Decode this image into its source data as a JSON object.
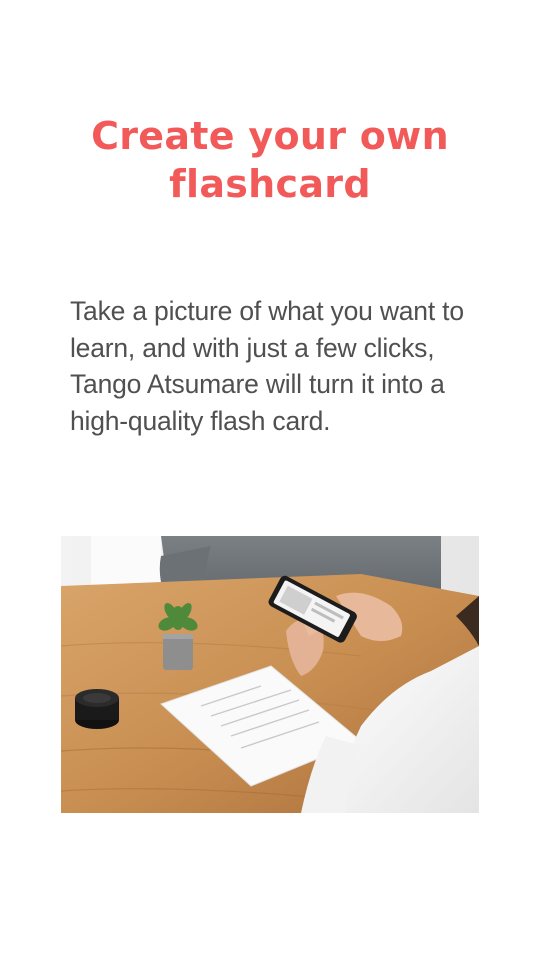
{
  "header": {
    "title": "Create your own flashcard"
  },
  "body": {
    "description": "Take a picture of what you want to learn, and with just a few clicks, Tango Atsumare will turn it into a high-quality flash card."
  },
  "illustration": {
    "kind": "photo-person-holding-smartphone"
  },
  "colors": {
    "accent": "#f25a5a",
    "text": "#505050",
    "background": "#ffffff"
  }
}
